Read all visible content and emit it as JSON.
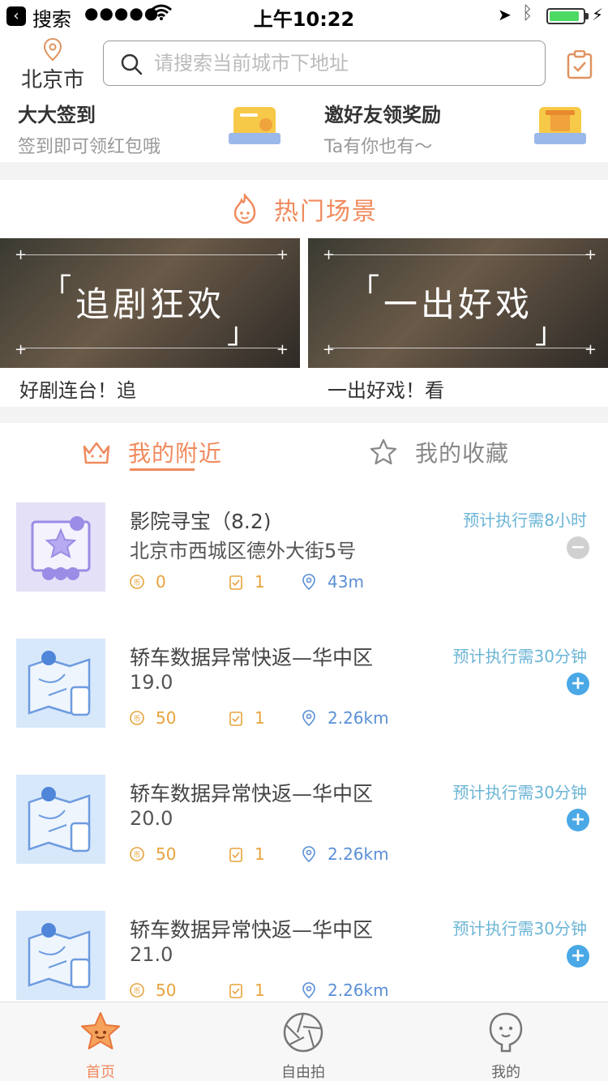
{
  "status_bar": {
    "back_app": "搜索",
    "signal": "●●●●●",
    "time": "上午10:22",
    "battery_level": 0.9
  },
  "header": {
    "city": "北京市",
    "search_placeholder": "请搜索当前城市下地址"
  },
  "promos": [
    {
      "title": "大大签到",
      "subtitle": "签到即可领红包哦"
    },
    {
      "title": "邀好友领奖励",
      "subtitle": "Ta有你也有～"
    }
  ],
  "hot": {
    "title": "热门场景",
    "scenes": [
      {
        "overlay": "追剧狂欢",
        "caption": "好剧连台！追"
      },
      {
        "overlay": "一出好戏",
        "caption": "一出好戏！看"
      }
    ]
  },
  "tabs": [
    {
      "label": "我的附近",
      "active": true
    },
    {
      "label": "我的收藏",
      "active": false
    }
  ],
  "tasks": [
    {
      "title": "影院寻宝（8.2)",
      "subtitle": "北京市西城区德外大街5号",
      "eta": "预计执行需8小时",
      "coins": "0",
      "count": "1",
      "distance": "43m",
      "action": "remove",
      "thumb": "cinema"
    },
    {
      "title": "轿车数据异常快返—华中区",
      "subtitle": "19.0",
      "eta": "预计执行需30分钟",
      "coins": "50",
      "count": "1",
      "distance": "2.26km",
      "action": "add",
      "thumb": "map"
    },
    {
      "title": "轿车数据异常快返—华中区",
      "subtitle": "20.0",
      "eta": "预计执行需30分钟",
      "coins": "50",
      "count": "1",
      "distance": "2.26km",
      "action": "add",
      "thumb": "map"
    },
    {
      "title": "轿车数据异常快返—华中区",
      "subtitle": "21.0",
      "eta": "预计执行需30分钟",
      "coins": "50",
      "count": "1",
      "distance": "2.26km",
      "action": "add",
      "thumb": "map"
    }
  ],
  "bottom_nav": [
    {
      "label": "首页",
      "icon": "star-face-icon",
      "active": true
    },
    {
      "label": "自由拍",
      "icon": "aperture-icon",
      "active": false
    },
    {
      "label": "我的",
      "icon": "profile-face-icon",
      "active": false
    }
  ],
  "colors": {
    "accent": "#f08a5d",
    "eta": "#6bb5d6",
    "coin": "#e8a33d",
    "distance": "#5b8fd6",
    "add_button": "#4aa8e6",
    "remove_button": "#d0d0d0"
  }
}
